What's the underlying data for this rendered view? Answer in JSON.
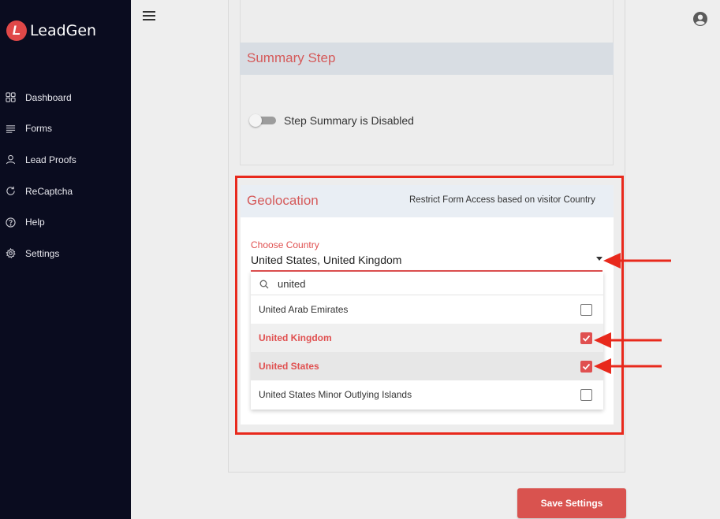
{
  "app": {
    "logo_letter": "L",
    "name": "LeadGen"
  },
  "sidebar": {
    "items": [
      {
        "label": "Dashboard",
        "icon": "dashboard-icon"
      },
      {
        "label": "Forms",
        "icon": "forms-icon"
      },
      {
        "label": "Lead Proofs",
        "icon": "user-icon"
      },
      {
        "label": "ReCaptcha",
        "icon": "recaptcha-icon"
      },
      {
        "label": "Help",
        "icon": "help-icon"
      },
      {
        "label": "Settings",
        "icon": "gear-icon"
      }
    ]
  },
  "summary": {
    "title": "Summary Step",
    "toggle_label": "Step Summary is Disabled",
    "toggle_on": false
  },
  "geolocation": {
    "title": "Geolocation",
    "subtitle": "Restrict Form Access based on visitor Country",
    "select_label": "Choose Country",
    "select_value": "United States, United Kingdom",
    "search_value": "united",
    "options": [
      {
        "label": "United Arab Emirates",
        "checked": false
      },
      {
        "label": "United Kingdom",
        "checked": true
      },
      {
        "label": "United States",
        "checked": true
      },
      {
        "label": "United States Minor Outlying Islands",
        "checked": false
      }
    ]
  },
  "footer": {
    "save_label": "Save Settings"
  },
  "colors": {
    "accent": "#e05050",
    "sidebar_bg": "#0a0c1f",
    "annotation": "#e8291c"
  }
}
